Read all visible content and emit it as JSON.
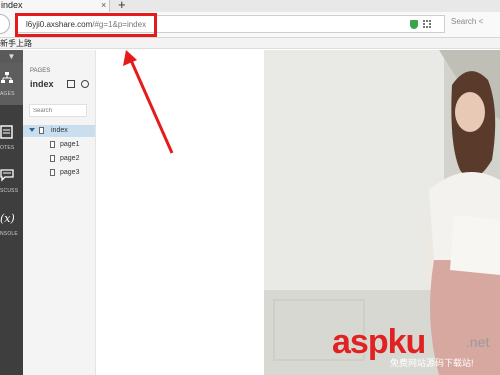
{
  "browser": {
    "tab_title": "index",
    "tab_close": "×",
    "new_tab": "+",
    "url_host": "l6yji0.axshare.com",
    "url_path": "/#g=1&p=index",
    "search_placeholder": "Search <",
    "bookmark": "新手上路"
  },
  "rail": {
    "collapse": "▼",
    "buttons": [
      {
        "label": "AGES",
        "icon": "sitemap-icon"
      },
      {
        "label": "OTES",
        "icon": "notes-icon"
      },
      {
        "label": "SCUSS",
        "icon": "discuss-icon"
      },
      {
        "label": "NSOLE",
        "icon": "console-icon"
      }
    ]
  },
  "pages_panel": {
    "title": "PAGES",
    "current": "index",
    "search_placeholder": "Search",
    "tree": [
      {
        "label": "index",
        "selected": true
      },
      {
        "label": "page1",
        "selected": false
      },
      {
        "label": "page2",
        "selected": false
      },
      {
        "label": "page3",
        "selected": false
      }
    ]
  },
  "watermark": {
    "brand": "aspku",
    "suffix": ".net",
    "subtitle": "免费网站源码下载站!"
  },
  "colors": {
    "highlight": "#e51b1b",
    "selection": "#c9dff0",
    "rail": "#3e3e3e"
  }
}
